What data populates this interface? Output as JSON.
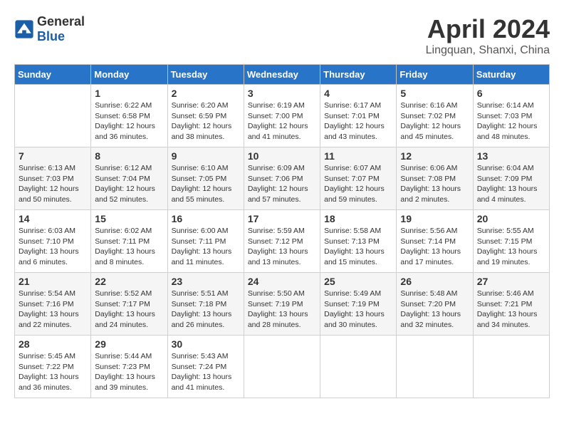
{
  "header": {
    "logo_general": "General",
    "logo_blue": "Blue",
    "title": "April 2024",
    "subtitle": "Lingquan, Shanxi, China"
  },
  "calendar": {
    "weekdays": [
      "Sunday",
      "Monday",
      "Tuesday",
      "Wednesday",
      "Thursday",
      "Friday",
      "Saturday"
    ],
    "weeks": [
      [
        {
          "day": "",
          "info": ""
        },
        {
          "day": "1",
          "info": "Sunrise: 6:22 AM\nSunset: 6:58 PM\nDaylight: 12 hours\nand 36 minutes."
        },
        {
          "day": "2",
          "info": "Sunrise: 6:20 AM\nSunset: 6:59 PM\nDaylight: 12 hours\nand 38 minutes."
        },
        {
          "day": "3",
          "info": "Sunrise: 6:19 AM\nSunset: 7:00 PM\nDaylight: 12 hours\nand 41 minutes."
        },
        {
          "day": "4",
          "info": "Sunrise: 6:17 AM\nSunset: 7:01 PM\nDaylight: 12 hours\nand 43 minutes."
        },
        {
          "day": "5",
          "info": "Sunrise: 6:16 AM\nSunset: 7:02 PM\nDaylight: 12 hours\nand 45 minutes."
        },
        {
          "day": "6",
          "info": "Sunrise: 6:14 AM\nSunset: 7:03 PM\nDaylight: 12 hours\nand 48 minutes."
        }
      ],
      [
        {
          "day": "7",
          "info": "Sunrise: 6:13 AM\nSunset: 7:03 PM\nDaylight: 12 hours\nand 50 minutes."
        },
        {
          "day": "8",
          "info": "Sunrise: 6:12 AM\nSunset: 7:04 PM\nDaylight: 12 hours\nand 52 minutes."
        },
        {
          "day": "9",
          "info": "Sunrise: 6:10 AM\nSunset: 7:05 PM\nDaylight: 12 hours\nand 55 minutes."
        },
        {
          "day": "10",
          "info": "Sunrise: 6:09 AM\nSunset: 7:06 PM\nDaylight: 12 hours\nand 57 minutes."
        },
        {
          "day": "11",
          "info": "Sunrise: 6:07 AM\nSunset: 7:07 PM\nDaylight: 12 hours\nand 59 minutes."
        },
        {
          "day": "12",
          "info": "Sunrise: 6:06 AM\nSunset: 7:08 PM\nDaylight: 13 hours\nand 2 minutes."
        },
        {
          "day": "13",
          "info": "Sunrise: 6:04 AM\nSunset: 7:09 PM\nDaylight: 13 hours\nand 4 minutes."
        }
      ],
      [
        {
          "day": "14",
          "info": "Sunrise: 6:03 AM\nSunset: 7:10 PM\nDaylight: 13 hours\nand 6 minutes."
        },
        {
          "day": "15",
          "info": "Sunrise: 6:02 AM\nSunset: 7:11 PM\nDaylight: 13 hours\nand 8 minutes."
        },
        {
          "day": "16",
          "info": "Sunrise: 6:00 AM\nSunset: 7:11 PM\nDaylight: 13 hours\nand 11 minutes."
        },
        {
          "day": "17",
          "info": "Sunrise: 5:59 AM\nSunset: 7:12 PM\nDaylight: 13 hours\nand 13 minutes."
        },
        {
          "day": "18",
          "info": "Sunrise: 5:58 AM\nSunset: 7:13 PM\nDaylight: 13 hours\nand 15 minutes."
        },
        {
          "day": "19",
          "info": "Sunrise: 5:56 AM\nSunset: 7:14 PM\nDaylight: 13 hours\nand 17 minutes."
        },
        {
          "day": "20",
          "info": "Sunrise: 5:55 AM\nSunset: 7:15 PM\nDaylight: 13 hours\nand 19 minutes."
        }
      ],
      [
        {
          "day": "21",
          "info": "Sunrise: 5:54 AM\nSunset: 7:16 PM\nDaylight: 13 hours\nand 22 minutes."
        },
        {
          "day": "22",
          "info": "Sunrise: 5:52 AM\nSunset: 7:17 PM\nDaylight: 13 hours\nand 24 minutes."
        },
        {
          "day": "23",
          "info": "Sunrise: 5:51 AM\nSunset: 7:18 PM\nDaylight: 13 hours\nand 26 minutes."
        },
        {
          "day": "24",
          "info": "Sunrise: 5:50 AM\nSunset: 7:19 PM\nDaylight: 13 hours\nand 28 minutes."
        },
        {
          "day": "25",
          "info": "Sunrise: 5:49 AM\nSunset: 7:19 PM\nDaylight: 13 hours\nand 30 minutes."
        },
        {
          "day": "26",
          "info": "Sunrise: 5:48 AM\nSunset: 7:20 PM\nDaylight: 13 hours\nand 32 minutes."
        },
        {
          "day": "27",
          "info": "Sunrise: 5:46 AM\nSunset: 7:21 PM\nDaylight: 13 hours\nand 34 minutes."
        }
      ],
      [
        {
          "day": "28",
          "info": "Sunrise: 5:45 AM\nSunset: 7:22 PM\nDaylight: 13 hours\nand 36 minutes."
        },
        {
          "day": "29",
          "info": "Sunrise: 5:44 AM\nSunset: 7:23 PM\nDaylight: 13 hours\nand 39 minutes."
        },
        {
          "day": "30",
          "info": "Sunrise: 5:43 AM\nSunset: 7:24 PM\nDaylight: 13 hours\nand 41 minutes."
        },
        {
          "day": "",
          "info": ""
        },
        {
          "day": "",
          "info": ""
        },
        {
          "day": "",
          "info": ""
        },
        {
          "day": "",
          "info": ""
        }
      ]
    ]
  }
}
